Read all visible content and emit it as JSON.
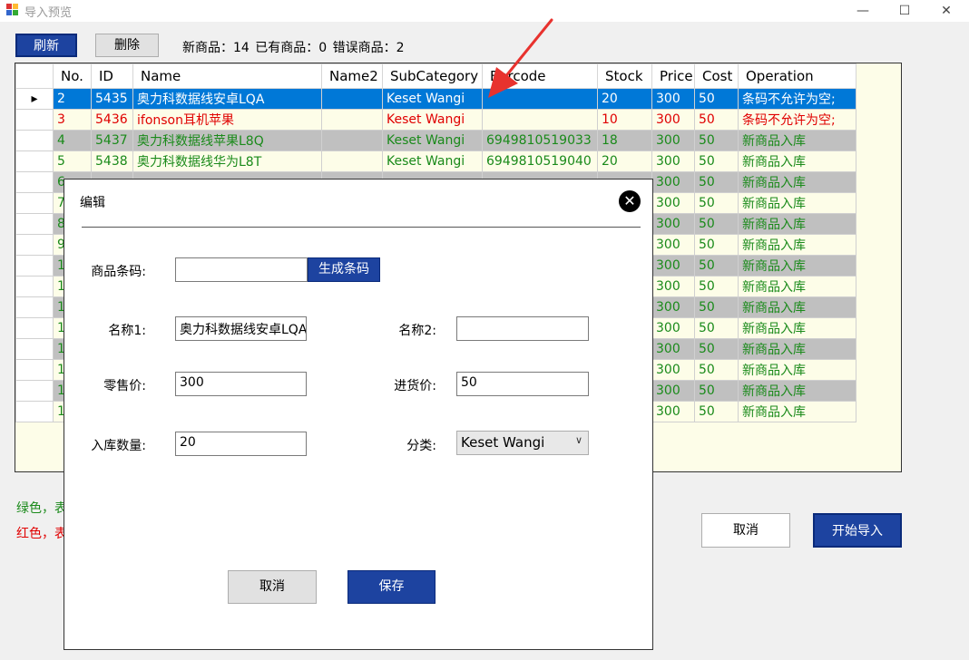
{
  "window": {
    "title": "导入预览",
    "minimize": "—",
    "maximize": "☐",
    "close": "✕"
  },
  "toolbar": {
    "refresh_label": "刷新",
    "delete_label": "删除",
    "summary": "新商品：14  已有商品：0  错误商品：2"
  },
  "grid": {
    "columns": [
      "No.",
      "ID",
      "Name",
      "Name2",
      "SubCategory",
      "Barcode",
      "Stock",
      "Price",
      "Cost",
      "Operation"
    ],
    "rows": [
      {
        "no": "2",
        "id": "5435",
        "name": "奥力科数据线安卓LQA",
        "name2": "",
        "sub": "Keset Wangi",
        "barcode": "",
        "stock": "20",
        "price": "300",
        "cost": "50",
        "op": "条码不允许为空;",
        "cls": "c-blue",
        "marker": "▸"
      },
      {
        "no": "3",
        "id": "5436",
        "name": "ifonson耳机苹果",
        "name2": "",
        "sub": "Keset Wangi",
        "barcode": "",
        "stock": "10",
        "price": "300",
        "cost": "50",
        "op": "条码不允许为空;",
        "cls": "c-red",
        "marker": ""
      },
      {
        "no": "4",
        "id": "5437",
        "name": "奥力科数据线苹果L8Q",
        "name2": "",
        "sub": "Keset Wangi",
        "barcode": "6949810519033",
        "stock": "18",
        "price": "300",
        "cost": "50",
        "op": "新商品入库",
        "cls": "c-green bg-gray",
        "marker": ""
      },
      {
        "no": "5",
        "id": "5438",
        "name": "奥力科数据线华为L8T",
        "name2": "",
        "sub": "Keset Wangi",
        "barcode": "6949810519040",
        "stock": "20",
        "price": "300",
        "cost": "50",
        "op": "新商品入库",
        "cls": "c-green bg-light",
        "marker": ""
      },
      {
        "no": "6",
        "id": "",
        "name": "",
        "name2": "",
        "sub": "",
        "barcode": "",
        "stock": "",
        "price": "300",
        "cost": "50",
        "op": "新商品入库",
        "cls": "c-green bg-gray",
        "marker": ""
      },
      {
        "no": "7",
        "id": "",
        "name": "",
        "name2": "",
        "sub": "",
        "barcode": "",
        "stock": "",
        "price": "300",
        "cost": "50",
        "op": "新商品入库",
        "cls": "c-green bg-light",
        "marker": ""
      },
      {
        "no": "8",
        "id": "",
        "name": "",
        "name2": "",
        "sub": "",
        "barcode": "",
        "stock": "",
        "price": "300",
        "cost": "50",
        "op": "新商品入库",
        "cls": "c-green bg-gray",
        "marker": ""
      },
      {
        "no": "9",
        "id": "",
        "name": "",
        "name2": "",
        "sub": "",
        "barcode": "",
        "stock": "",
        "price": "300",
        "cost": "50",
        "op": "新商品入库",
        "cls": "c-green bg-light",
        "marker": ""
      },
      {
        "no": "1",
        "id": "",
        "name": "",
        "name2": "",
        "sub": "",
        "barcode": "",
        "stock": "",
        "price": "300",
        "cost": "50",
        "op": "新商品入库",
        "cls": "c-green bg-gray",
        "marker": ""
      },
      {
        "no": "1",
        "id": "",
        "name": "",
        "name2": "",
        "sub": "",
        "barcode": "",
        "stock": "",
        "price": "300",
        "cost": "50",
        "op": "新商品入库",
        "cls": "c-green bg-light",
        "marker": ""
      },
      {
        "no": "1",
        "id": "",
        "name": "",
        "name2": "",
        "sub": "",
        "barcode": "",
        "stock": "",
        "price": "300",
        "cost": "50",
        "op": "新商品入库",
        "cls": "c-green bg-gray",
        "marker": ""
      },
      {
        "no": "1",
        "id": "",
        "name": "",
        "name2": "",
        "sub": "",
        "barcode": "",
        "stock": "",
        "price": "300",
        "cost": "50",
        "op": "新商品入库",
        "cls": "c-green bg-light",
        "marker": ""
      },
      {
        "no": "1",
        "id": "",
        "name": "",
        "name2": "",
        "sub": "",
        "barcode": "",
        "stock": "",
        "price": "300",
        "cost": "50",
        "op": "新商品入库",
        "cls": "c-green bg-gray",
        "marker": ""
      },
      {
        "no": "1",
        "id": "",
        "name": "",
        "name2": "",
        "sub": "",
        "barcode": "",
        "stock": "",
        "price": "300",
        "cost": "50",
        "op": "新商品入库",
        "cls": "c-green bg-light",
        "marker": ""
      },
      {
        "no": "1",
        "id": "",
        "name": "",
        "name2": "",
        "sub": "",
        "barcode": "",
        "stock": "",
        "price": "300",
        "cost": "50",
        "op": "新商品入库",
        "cls": "c-green bg-gray",
        "marker": ""
      },
      {
        "no": "1",
        "id": "",
        "name": "",
        "name2": "",
        "sub": "",
        "barcode": "",
        "stock": "",
        "price": "300",
        "cost": "50",
        "op": "新商品入库",
        "cls": "c-green bg-light",
        "marker": ""
      }
    ]
  },
  "legend": {
    "green": "绿色，表",
    "red": "红色，表"
  },
  "main_buttons": {
    "cancel": "取消",
    "start_import": "开始导入"
  },
  "dialog": {
    "title": "编辑",
    "close": "✕",
    "barcode_label": "商品条码:",
    "barcode_value": "",
    "generate_barcode": "生成条码",
    "name1_label": "名称1:",
    "name1_value": "奥力科数据线安卓LQA",
    "name2_label": "名称2:",
    "name2_value": "",
    "retail_price_label": "零售价:",
    "retail_price_value": "300",
    "purchase_price_label": "进货价:",
    "purchase_price_value": "50",
    "quantity_label": "入库数量:",
    "quantity_value": "20",
    "category_label": "分类:",
    "category_value": "Keset Wangi",
    "cancel": "取消",
    "save": "保存"
  },
  "colors": {
    "accent": "#1d43a0",
    "selection": "#0078d7",
    "error": "#e00000",
    "success": "#1a8a1a",
    "grid_bg": "#fdfde8",
    "alt_row": "#c0c0c0"
  }
}
